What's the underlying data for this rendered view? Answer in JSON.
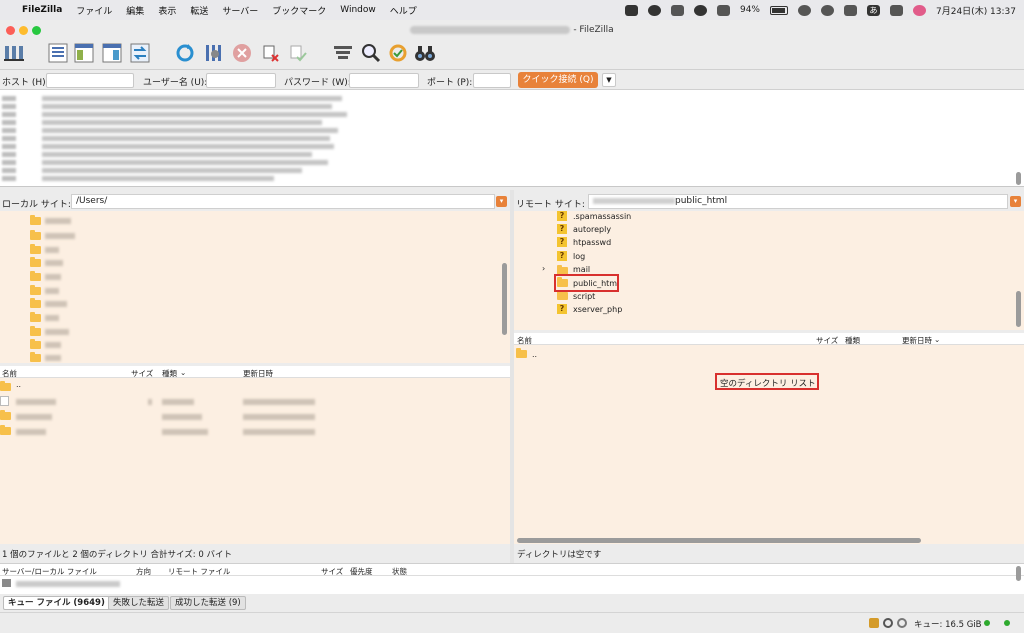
{
  "menubar": {
    "app": "FileZilla",
    "items": [
      "ファイル",
      "編集",
      "表示",
      "転送",
      "サーバー",
      "ブックマーク",
      "Window",
      "ヘルプ"
    ],
    "battery": "94%",
    "ime": "あ",
    "datetime": "7月24日(木)  13:37"
  },
  "window": {
    "title_suffix": "- FileZilla"
  },
  "quickconnect": {
    "host_label": "ホスト (H):",
    "user_label": "ユーザー名 (U):",
    "password_label": "パスワード (W):",
    "port_label": "ポート (P):",
    "button": "クイック接続 (Q)",
    "dropdown": "▼"
  },
  "local": {
    "site_label": "ローカル サイト:",
    "path": "/Users/",
    "columns": [
      "名前",
      "サイズ",
      "種類",
      "更新日時"
    ],
    "parent": "..",
    "status": "1 個のファイルと 2 個のディレクトリ 合計サイズ: 0 バイト"
  },
  "remote": {
    "site_label": "リモート サイト:",
    "path_suffix": "public_html",
    "tree": [
      {
        "name": ".spamassassin",
        "icon": "question-icon"
      },
      {
        "name": "autoreply",
        "icon": "question-icon"
      },
      {
        "name": "htpasswd",
        "icon": "question-icon"
      },
      {
        "name": "log",
        "icon": "question-icon"
      },
      {
        "name": "mail",
        "icon": "folder-icon",
        "expandable": true
      },
      {
        "name": "public_html",
        "icon": "folder-icon",
        "selected": true
      },
      {
        "name": "script",
        "icon": "folder-icon"
      },
      {
        "name": "xserver_php",
        "icon": "question-icon"
      }
    ],
    "columns": [
      "名前",
      "サイズ",
      "種類",
      "更新日時"
    ],
    "parent": "..",
    "empty_message": "空のディレクトリ リスト",
    "status": "ディレクトリは空です"
  },
  "queue": {
    "columns": [
      "サーバー/ローカル ファイル",
      "方向",
      "リモート ファイル",
      "サイズ",
      "優先度",
      "状態"
    ],
    "tabs": [
      "キュー ファイル (9649)",
      "失敗した転送",
      "成功した転送 (9)"
    ]
  },
  "statusbar": {
    "queue": "キュー: 16.5 GiB"
  },
  "colors": {
    "accent": "#e8823a",
    "pane_bg": "#fcefe2",
    "highlight_box": "#d8302e",
    "folder": "#f7c04a"
  }
}
